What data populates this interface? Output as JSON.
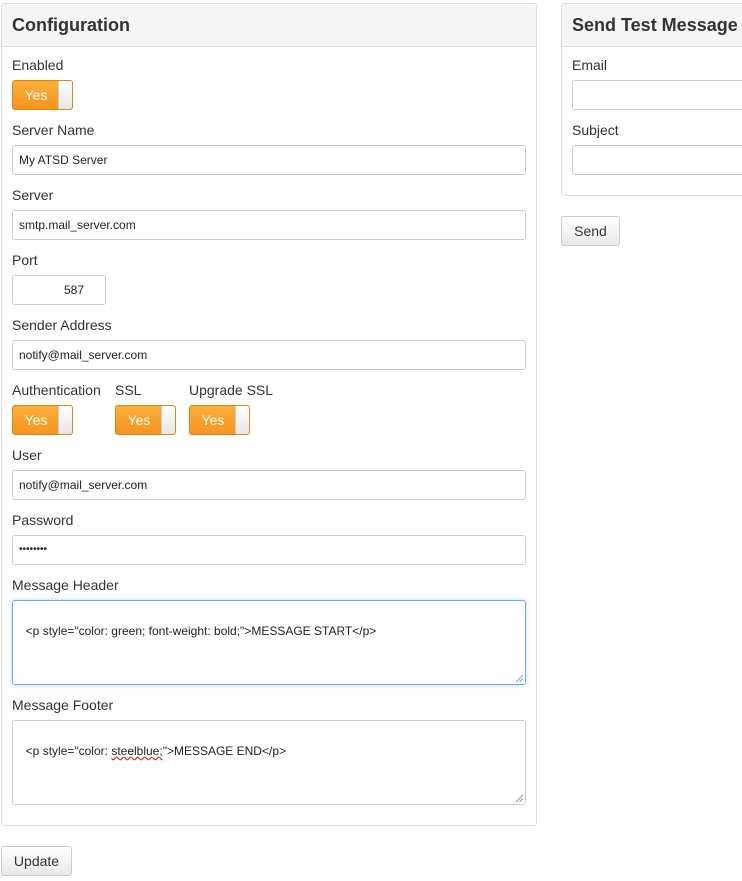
{
  "configuration": {
    "title": "Configuration",
    "enabled": {
      "label": "Enabled",
      "value": "Yes"
    },
    "server_name": {
      "label": "Server Name",
      "value": "My ATSD Server"
    },
    "server": {
      "label": "Server",
      "value": "smtp.mail_server.com"
    },
    "port": {
      "label": "Port",
      "value": "587"
    },
    "sender_address": {
      "label": "Sender Address",
      "value": "notify@mail_server.com"
    },
    "authentication": {
      "label": "Authentication",
      "value": "Yes"
    },
    "ssl": {
      "label": "SSL",
      "value": "Yes"
    },
    "upgrade_ssl": {
      "label": "Upgrade SSL",
      "value": "Yes"
    },
    "user": {
      "label": "User",
      "value": "notify@mail_server.com"
    },
    "password": {
      "label": "Password",
      "value": "••••••••"
    },
    "message_header": {
      "label": "Message Header",
      "value": "<p style=\"color: green; font-weight: bold;\">MESSAGE START</p>"
    },
    "message_footer": {
      "label": "Message Footer",
      "value_pre": "<p style=\"color: ",
      "value_spell": "steelblue;",
      "value_post": "\">MESSAGE END</p>"
    }
  },
  "update_button": "Update",
  "test_message": {
    "title": "Send Test Message",
    "email": {
      "label": "Email",
      "value": ""
    },
    "subject": {
      "label": "Subject",
      "value": ""
    },
    "send_button": "Send"
  },
  "colors": {
    "toggle_on": "#f7941d",
    "focus_border": "#66afe9"
  }
}
